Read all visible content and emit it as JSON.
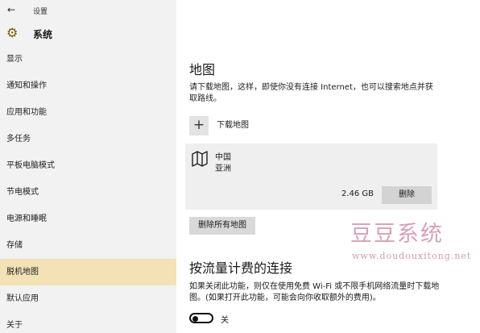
{
  "window": {
    "back_icon": "back-arrow-icon",
    "title": "设置"
  },
  "header": {
    "icon": "gear-icon",
    "title": "系统"
  },
  "sidebar": {
    "items": [
      {
        "label": "显示"
      },
      {
        "label": "通知和操作"
      },
      {
        "label": "应用和功能"
      },
      {
        "label": "多任务"
      },
      {
        "label": "平板电脑模式"
      },
      {
        "label": "节电模式"
      },
      {
        "label": "电源和睡眠"
      },
      {
        "label": "存储"
      },
      {
        "label": "脱机地图",
        "selected": true
      },
      {
        "label": "默认应用"
      },
      {
        "label": "关于"
      }
    ]
  },
  "main": {
    "maps_title": "地图",
    "maps_description": "请下载地图，这样，即使你没有连接 Internet，也可以搜索地点并获取路线。",
    "download": {
      "icon": "plus-icon",
      "label": "下载地图"
    },
    "downloaded_map": {
      "icon": "map-icon",
      "country": "中国",
      "region": "亚洲",
      "size": "2.46 GB",
      "delete_label": "删除"
    },
    "delete_all_label": "删除所有地图",
    "metered_title": "按流量计费的连接",
    "metered_description": "如果关闭此功能，则仅在使用免费 Wi-Fi 或不限手机网络流量时下载地图。(如果打开此功能，可能会向你收取额外的费用)。",
    "toggle": {
      "state": "off",
      "label": "关"
    }
  },
  "watermark": {
    "title": "豆豆系统",
    "url": "www.doudouxitong.net"
  },
  "colors": {
    "sidebar_bg": "#f2f2f2",
    "selected_bg": "#f2e2b6",
    "watermark": "#d8a0b6"
  }
}
